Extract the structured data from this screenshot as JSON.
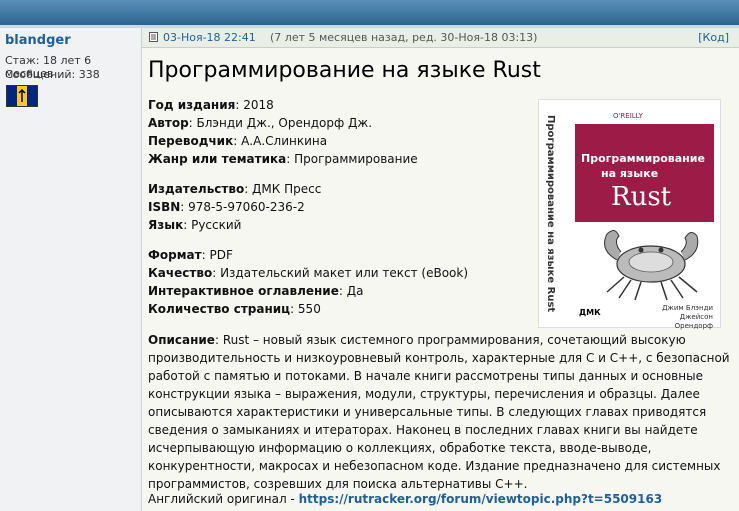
{
  "user": {
    "name": "blandger",
    "tenure_label": "Стаж:",
    "tenure_value": "18 лет 6 месяцев",
    "posts_label": "Сообщений:",
    "posts_value": "338"
  },
  "post_header": {
    "date": "03-Ноя-18 22:41",
    "ago": "(7 лет 5 месяцев назад, ред. 30-Ноя-18 03:13)",
    "code_link": "[Код]"
  },
  "title": "Программирование на языке Rust",
  "fields": [
    {
      "label": "Год издания",
      "value": "2018"
    },
    {
      "label": "Автор",
      "value": "Блэнди Дж., Орендорф Дж."
    },
    {
      "label": "Переводчик",
      "value": "А.А.Слинкина"
    },
    {
      "label": "Жанр или тематика",
      "value": "Программирование"
    },
    {
      "label": "Издательство",
      "value": "ДМК Пресс"
    },
    {
      "label": "ISBN",
      "value": "978-5-97060-236-2"
    },
    {
      "label": "Язык",
      "value": "Русский"
    },
    {
      "label": "Формат",
      "value": "PDF"
    },
    {
      "label": "Качество",
      "value": "Издательский макет или текст (eBook)"
    },
    {
      "label": "Интерактивное оглавление",
      "value": "Да"
    },
    {
      "label": "Количество страниц",
      "value": "550"
    }
  ],
  "description": {
    "label": "Описание",
    "text": "Rust – новый язык системного программирования, сочетающий высокую производительность и низкоуровневый контроль, характерные для C и C++, с безопасной работой с памятью и потоками. В начале книги рассмотрены типы данных и основные конструкции языка – выражения, модули, структуры, перечисления и образцы. Далее описываются характеристики и универсальные типы. В следующих главах приводятся сведения о замыканиях и итераторах. Наконец в последних главах книги вы найдете исчерпывающую информацию о коллекциях, обработке текста, вводе-выводе, конкурентности, макросах и небезопасном коде. Издание предназначено для системных программистов, созревших для поиска альтернативы C++."
  },
  "original": {
    "label": "Английский оригинал -",
    "link": "https://rutracker.org/forum/viewtopic.php?t=5509163"
  },
  "cover": {
    "spine": "Программирование на языке Rust",
    "publisher_mark": "O'REILLY",
    "title_line1": "Программирование",
    "title_line2": "на языке",
    "title_line3": "Rust",
    "authors_line1": "Джим Блэнди",
    "authors_line2": "Джейсон Орендорф",
    "imprint": "ДМК"
  }
}
